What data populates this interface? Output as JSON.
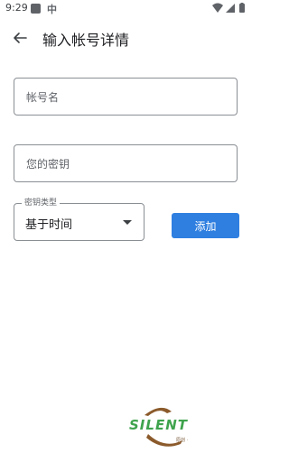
{
  "status_bar": {
    "time": "9:29",
    "app_char": "中"
  },
  "app_bar": {
    "title": "输入帐号详情"
  },
  "form": {
    "account_name": {
      "placeholder": "帐号名"
    },
    "secret": {
      "placeholder": "您的密钥"
    },
    "key_type": {
      "label": "密钥类型",
      "value": "基于时间"
    },
    "add_button": "添加"
  },
  "watermark": {
    "text": "SILENT",
    "sub": "原创 ·"
  },
  "colors": {
    "primary": "#2f7fe0",
    "watermark_green": "#3fa34d",
    "watermark_brown": "#8b5a2b"
  },
  "icons": {
    "back": "arrow-left-icon",
    "dropdown": "caret-down-icon",
    "wifi": "wifi-icon",
    "signal": "signal-icon",
    "battery": "battery-icon"
  }
}
